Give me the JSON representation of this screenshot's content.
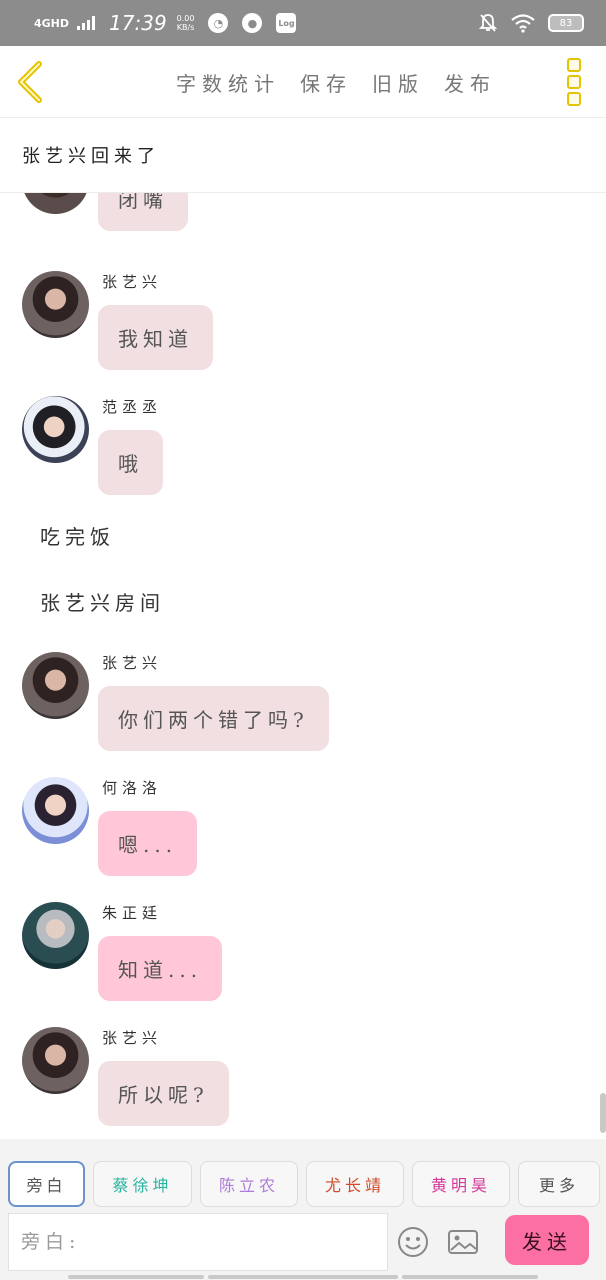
{
  "status_bar": {
    "network": "4GHD",
    "time": "17:39",
    "speed_value": "0.00",
    "speed_unit": "KB/s",
    "log_label": "Log",
    "battery": "83"
  },
  "nav": {
    "links": [
      "字数统计",
      "保存",
      "旧版",
      "发布"
    ]
  },
  "title": "张艺兴回来了",
  "messages": {
    "m0": {
      "bubble": "闭嘴"
    },
    "m1": {
      "sender": "张艺兴",
      "bubble": "我知道"
    },
    "m2": {
      "sender": "范丞丞",
      "bubble": "哦"
    },
    "n1": "吃完饭",
    "n2": "张艺兴房间",
    "m3": {
      "sender": "张艺兴",
      "bubble": "你们两个错了吗?"
    },
    "m4": {
      "sender": "何洛洛",
      "bubble": "嗯..."
    },
    "m5": {
      "sender": "朱正廷",
      "bubble": "知道..."
    },
    "m6": {
      "sender": "张艺兴",
      "bubble": "所以呢?"
    }
  },
  "characters": [
    {
      "label": "旁白",
      "color": "#555555"
    },
    {
      "label": "蔡徐坤",
      "color": "#2bb3a0"
    },
    {
      "label": "陈立农",
      "color": "#b07ad9"
    },
    {
      "label": "尤长靖",
      "color": "#d14a2a"
    },
    {
      "label": "黄明昊",
      "color": "#d4379a"
    },
    {
      "label": "更多",
      "color": "#555555"
    }
  ],
  "input": {
    "placeholder": "旁白:"
  },
  "send_label": "发送",
  "colors": {
    "bubble_gray": "#f1dfe2",
    "bubble_pink": "#ffc7d8",
    "accent_yellow": "#e6c300",
    "send_pink": "#fb6fa3"
  }
}
